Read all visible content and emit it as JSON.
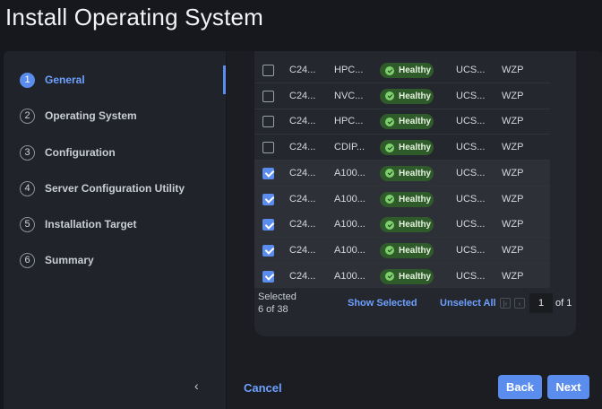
{
  "page_title": "Install Operating System",
  "sidebar": {
    "steps": [
      {
        "num": "1",
        "label": "General"
      },
      {
        "num": "2",
        "label": "Operating System"
      },
      {
        "num": "3",
        "label": "Configuration"
      },
      {
        "num": "4",
        "label": "Server Configuration Utility"
      },
      {
        "num": "5",
        "label": "Installation Target"
      },
      {
        "num": "6",
        "label": "Summary"
      }
    ],
    "active_step": "1",
    "collapse_icon": "chevron-left-icon",
    "collapse_glyph": "‹"
  },
  "table": {
    "rows": [
      {
        "name": "C24...",
        "model": "HPC...",
        "health": "Healthy",
        "ucs": "UCS...",
        "serial": "WZP",
        "checked": false
      },
      {
        "name": "C24...",
        "model": "NVC...",
        "health": "Healthy",
        "ucs": "UCS...",
        "serial": "WZP",
        "checked": false
      },
      {
        "name": "C24...",
        "model": "HPC...",
        "health": "Healthy",
        "ucs": "UCS...",
        "serial": "WZP",
        "checked": false
      },
      {
        "name": "C24...",
        "model": "CDIP...",
        "health": "Healthy",
        "ucs": "UCS...",
        "serial": "WZP",
        "checked": false
      },
      {
        "name": "C24...",
        "model": "A100...",
        "health": "Healthy",
        "ucs": "UCS...",
        "serial": "WZP",
        "checked": true
      },
      {
        "name": "C24...",
        "model": "A100...",
        "health": "Healthy",
        "ucs": "UCS...",
        "serial": "WZP",
        "checked": true
      },
      {
        "name": "C24...",
        "model": "A100...",
        "health": "Healthy",
        "ucs": "UCS...",
        "serial": "WZP",
        "checked": true
      },
      {
        "name": "C24...",
        "model": "A100...",
        "health": "Healthy",
        "ucs": "UCS...",
        "serial": "WZP",
        "checked": true
      },
      {
        "name": "C24...",
        "model": "A100...",
        "health": "Healthy",
        "ucs": "UCS...",
        "serial": "WZP",
        "checked": true
      }
    ]
  },
  "selection": {
    "label": "Selected",
    "count": "6 of 38",
    "show_selected": "Show Selected",
    "unselect_all": "Unselect All"
  },
  "pagination": {
    "first_icon": "first-page-icon",
    "prev_icon": "prev-page-icon",
    "page": "1",
    "of": "of 1"
  },
  "footer": {
    "cancel": "Cancel",
    "back": "Back",
    "next": "Next"
  },
  "colors": {
    "accent": "#5b8def",
    "healthy_bg": "#2f5a2a",
    "healthy_icon": "#7dd06c"
  }
}
